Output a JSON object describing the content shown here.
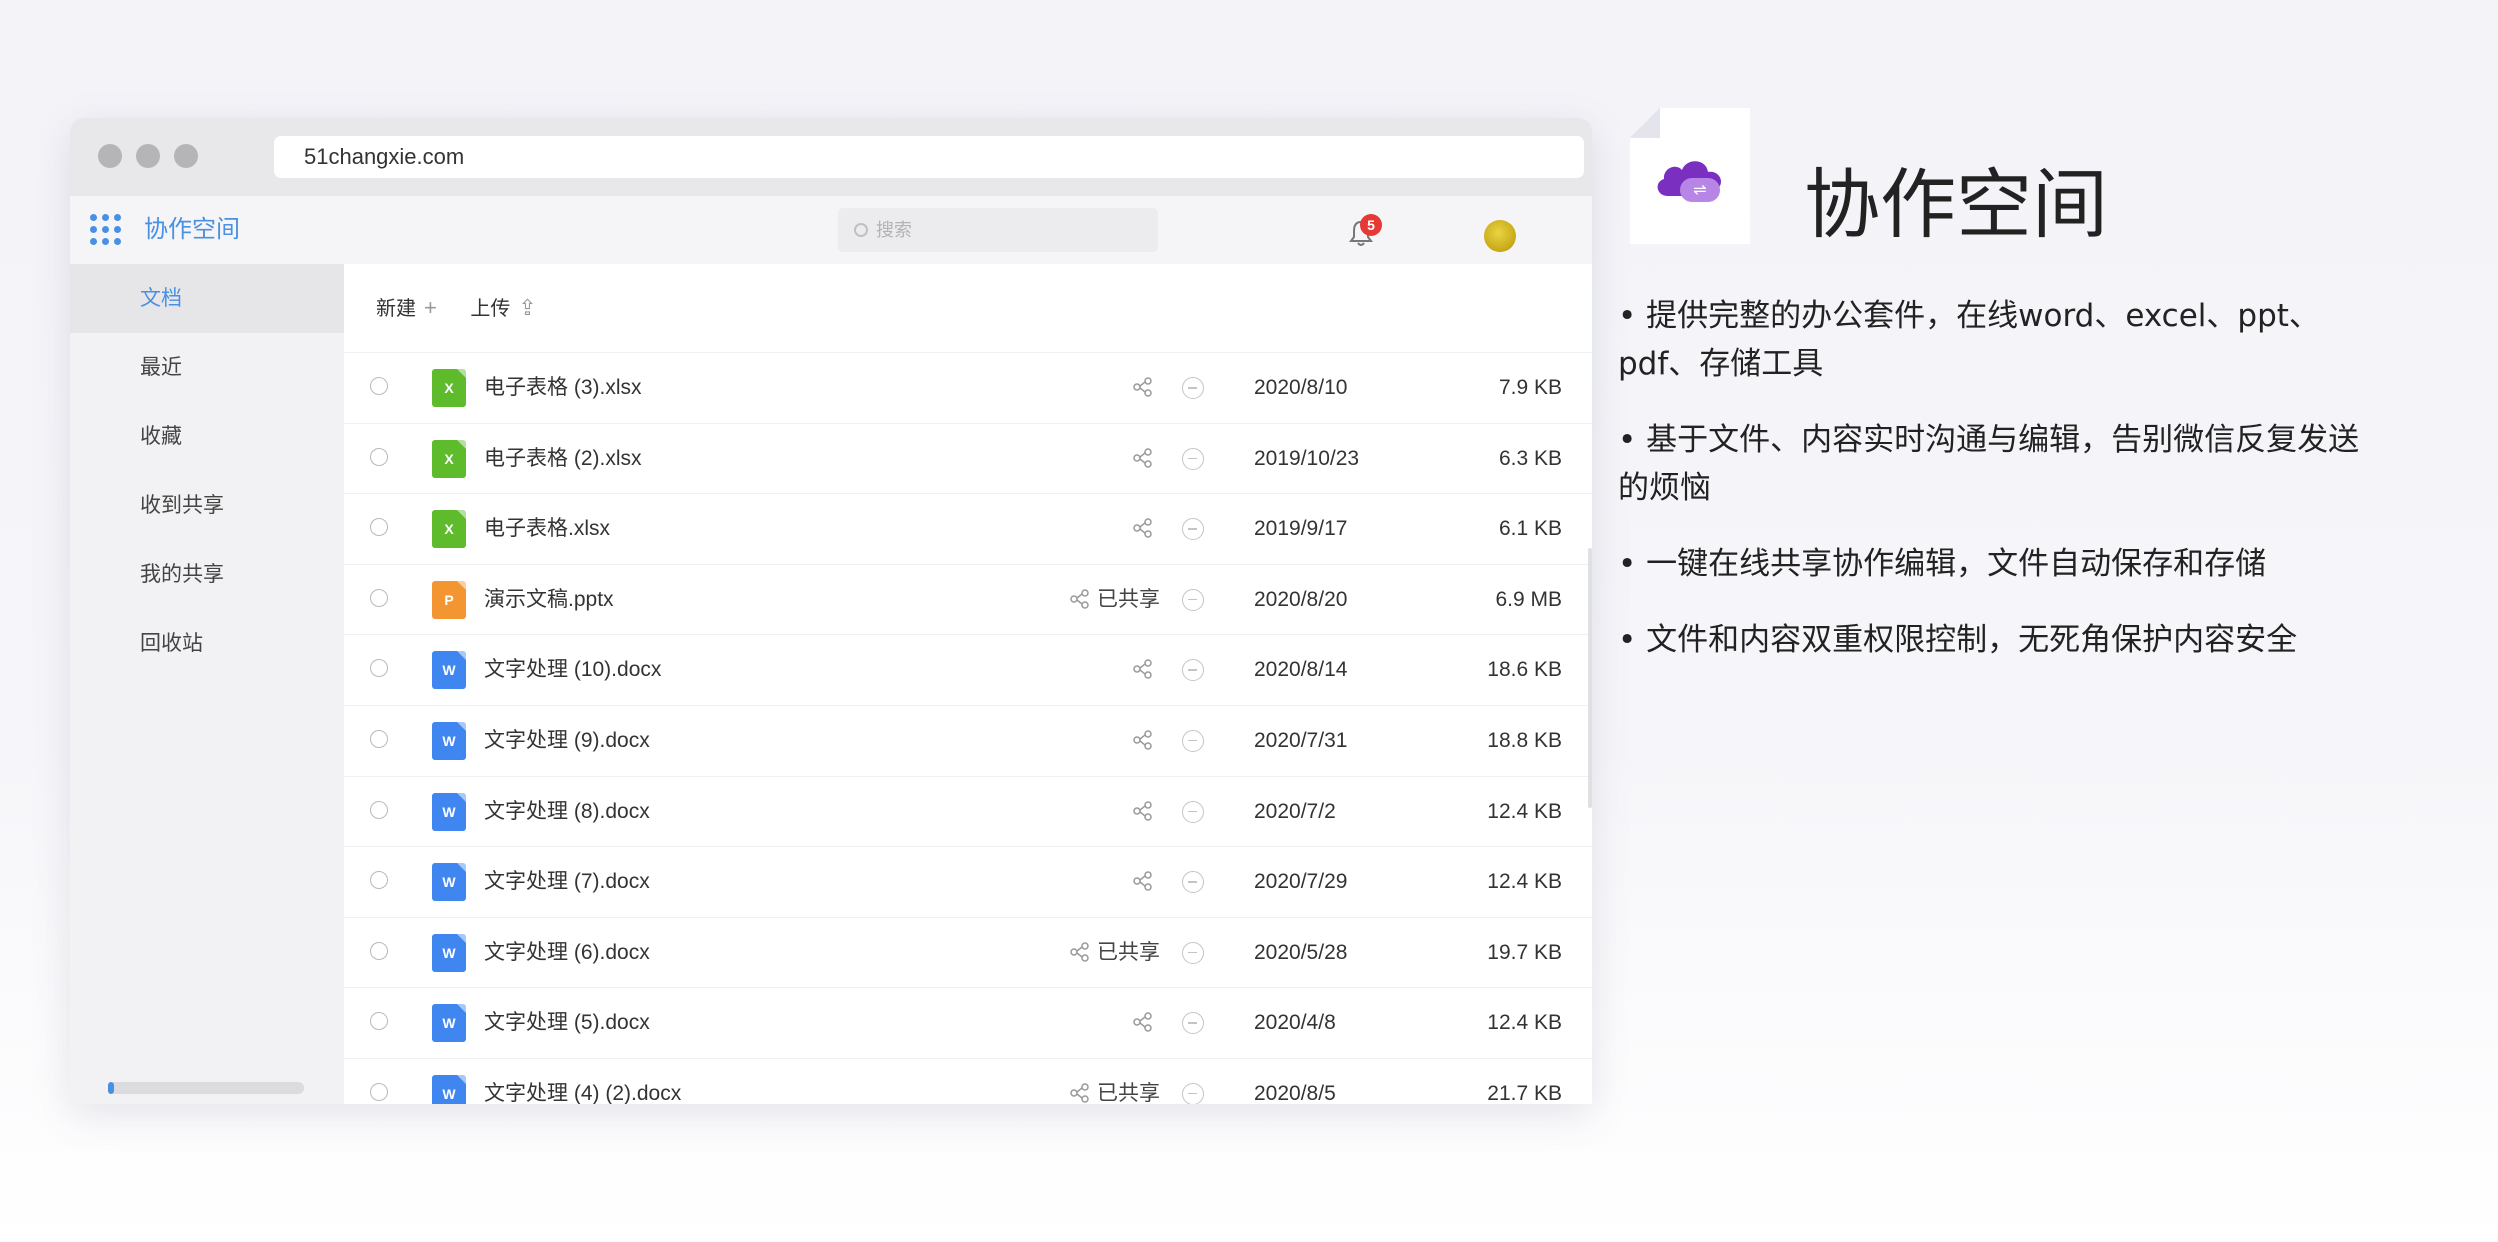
{
  "browser": {
    "url": "51changxie.com"
  },
  "app": {
    "brand": "协作空间",
    "search_placeholder": "搜索",
    "notification_count": "5"
  },
  "sidebar": {
    "items": [
      {
        "label": "文档",
        "active": true
      },
      {
        "label": "最近",
        "active": false
      },
      {
        "label": "收藏",
        "active": false
      },
      {
        "label": "收到共享",
        "active": false
      },
      {
        "label": "我的共享",
        "active": false
      },
      {
        "label": "回收站",
        "active": false
      }
    ],
    "storage_fraction": 0.03
  },
  "toolbar": {
    "new_label": "新建",
    "upload_label": "上传"
  },
  "files": [
    {
      "name": "电子表格 (3).xlsx",
      "type": "xlsx",
      "icon_letter": "X",
      "shared": "",
      "date": "2020/8/10",
      "size": "7.9 KB"
    },
    {
      "name": "电子表格 (2).xlsx",
      "type": "xlsx",
      "icon_letter": "X",
      "shared": "",
      "date": "2019/10/23",
      "size": "6.3 KB"
    },
    {
      "name": "电子表格.xlsx",
      "type": "xlsx",
      "icon_letter": "X",
      "shared": "",
      "date": "2019/9/17",
      "size": "6.1 KB"
    },
    {
      "name": "演示文稿.pptx",
      "type": "pptx",
      "icon_letter": "P",
      "shared": "已共享",
      "date": "2020/8/20",
      "size": "6.9 MB"
    },
    {
      "name": "文字处理 (10).docx",
      "type": "docx",
      "icon_letter": "W",
      "shared": "",
      "date": "2020/8/14",
      "size": "18.6 KB"
    },
    {
      "name": "文字处理 (9).docx",
      "type": "docx",
      "icon_letter": "W",
      "shared": "",
      "date": "2020/7/31",
      "size": "18.8 KB"
    },
    {
      "name": "文字处理 (8).docx",
      "type": "docx",
      "icon_letter": "W",
      "shared": "",
      "date": "2020/7/2",
      "size": "12.4 KB"
    },
    {
      "name": "文字处理 (7).docx",
      "type": "docx",
      "icon_letter": "W",
      "shared": "",
      "date": "2020/7/29",
      "size": "12.4 KB"
    },
    {
      "name": "文字处理 (6).docx",
      "type": "docx",
      "icon_letter": "W",
      "shared": "已共享",
      "date": "2020/5/28",
      "size": "19.7 KB"
    },
    {
      "name": "文字处理 (5).docx",
      "type": "docx",
      "icon_letter": "W",
      "shared": "",
      "date": "2020/4/8",
      "size": "12.4 KB"
    },
    {
      "name": "文字处理 (4) (2).docx",
      "type": "docx",
      "icon_letter": "W",
      "shared": "已共享",
      "date": "2020/8/5",
      "size": "21.7 KB"
    }
  ],
  "file_colors": {
    "xlsx": "#5dbb2c",
    "pptx": "#f39530",
    "docx": "#3f86f0"
  },
  "feature": {
    "title": "协作空间",
    "bullets": [
      "• 提供完整的办公套件，在线word、excel、ppt、pdf、存储工具",
      "• 基于文件、内容实时沟通与编辑，告别微信反复发送的烦恼",
      "• 一键在线共享协作编辑，文件自动保存和存储",
      "• 文件和内容双重权限控制，无死角保护内容安全"
    ]
  },
  "colors": {
    "accent": "#4a90e2",
    "badge": "#e53935",
    "cloud": "#8b3fc9"
  }
}
